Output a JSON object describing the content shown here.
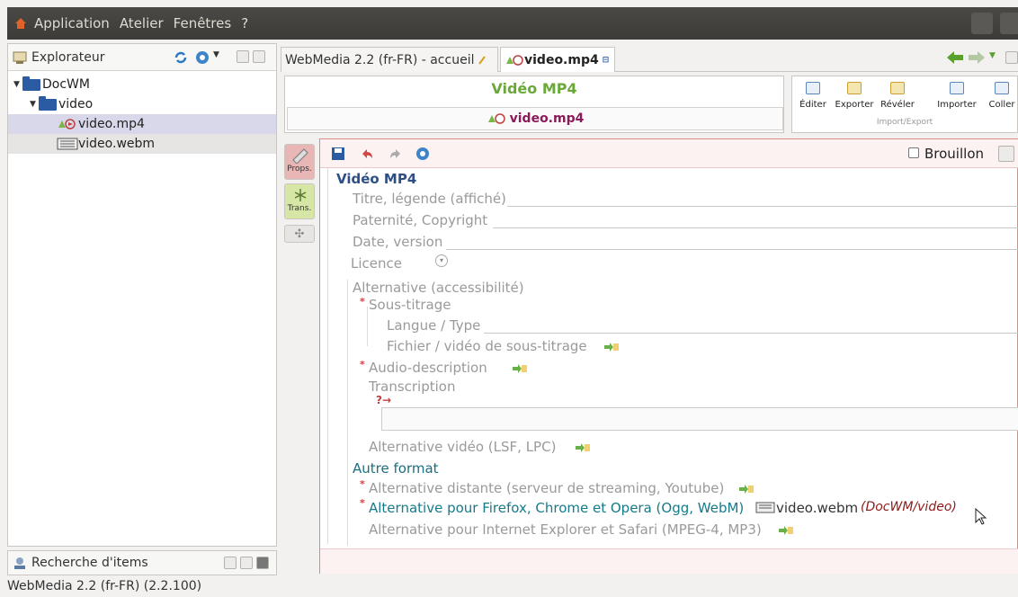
{
  "menu": {
    "items": [
      "Application",
      "Atelier",
      "Fenêtres",
      "?"
    ]
  },
  "explorer": {
    "title": "Explorateur",
    "tree": [
      {
        "label": "DocWM",
        "kind": "folder"
      },
      {
        "label": "video",
        "kind": "folder"
      },
      {
        "label": "video.mp4",
        "kind": "mp4"
      },
      {
        "label": "video.webm",
        "kind": "webm"
      }
    ]
  },
  "search": {
    "title": "Recherche d'items"
  },
  "status": {
    "text": "WebMedia 2.2 (fr-FR) (2.2.100)"
  },
  "tabs": {
    "home": "WebMedia 2.2 (fr-FR) - accueil",
    "doc": "video.mp4"
  },
  "header": {
    "type_title": "Vidéo MP4",
    "file_name": "video.mp4"
  },
  "toolbox": {
    "buttons": [
      "Éditer",
      "Exporter",
      "Révéler",
      "Importer",
      "Coller"
    ],
    "group_label": "Import/Export"
  },
  "sidetabs": {
    "props": "Props.",
    "trans": "Trans."
  },
  "editor": {
    "draft_label": "Brouillon",
    "section_title": "Vidéo MP4",
    "fields": {
      "title": "Titre, légende (affiché)",
      "authorship": "Paternité, Copyright",
      "date": "Date, version",
      "licence": "Licence"
    },
    "alt_section": "Alternative (accessibilité)",
    "subtitles": "Sous-titrage",
    "lang_type": "Langue / Type",
    "subtitle_file": "Fichier / vidéo de sous-titrage",
    "audio_desc": "Audio-description",
    "transcription": "Transcription",
    "alt_video": "Alternative vidéo (LSF, LPC)",
    "other_format": "Autre format",
    "alt_remote": "Alternative distante (serveur de streaming, Youtube)",
    "alt_firefox": "Alternative pour Firefox, Chrome et Opera (Ogg, WebM)",
    "alt_firefox_file": "video.webm",
    "alt_firefox_path": "(DocWM/video)",
    "alt_ie": "Alternative pour Internet Explorer et Safari (MPEG-4, MP3)"
  },
  "colors": {
    "accent_green": "#5aa02c",
    "section_blue": "#2e4f86",
    "teal": "#177a8a",
    "path_red": "#8b1a1a"
  }
}
